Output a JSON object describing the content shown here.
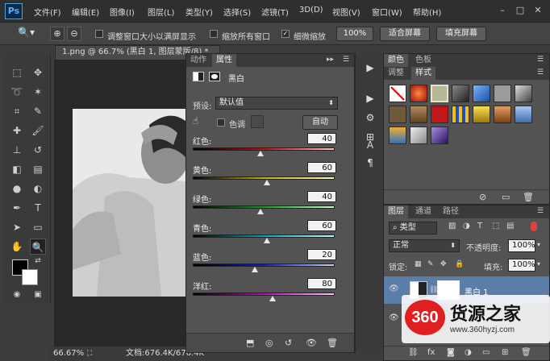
{
  "app": {
    "logo": "Ps"
  },
  "menu": [
    "文件(F)",
    "编辑(E)",
    "图像(I)",
    "图层(L)",
    "类型(Y)",
    "选择(S)",
    "滤镜(T)",
    "3D(D)",
    "视图(V)",
    "窗口(W)",
    "帮助(H)"
  ],
  "window_controls": [
    "–",
    "□",
    "✕"
  ],
  "options": {
    "resize_window": "调整窗口大小以满屏显示",
    "zoom_all": "缩放所有窗口",
    "scrubby_zoom": "细微缩放",
    "zoom_100": "100%",
    "fit_screen": "适合屏幕",
    "fill_screen": "填充屏幕"
  },
  "document": {
    "tab_title": "1.png @ 66.7% (黑白 1, 图层蒙版/8) *",
    "zoom": "66.67%",
    "doc_info": "文档:676.4K/676.4K"
  },
  "properties": {
    "tabs": [
      "动作",
      "属性"
    ],
    "title": "黑白",
    "preset_label": "预设:",
    "preset_value": "默认值",
    "tint_label": "色调",
    "auto_button": "自动",
    "sliders": [
      {
        "label": "红色:",
        "value": 40
      },
      {
        "label": "黄色:",
        "value": 60
      },
      {
        "label": "绿色:",
        "value": 40
      },
      {
        "label": "青色:",
        "value": 60
      },
      {
        "label": "蓝色:",
        "value": 20
      },
      {
        "label": "洋红:",
        "value": 80
      }
    ]
  },
  "color_panel": {
    "tabs": [
      "颜色",
      "色板"
    ]
  },
  "styles_panel": {
    "tabs": [
      "调整",
      "样式"
    ]
  },
  "layers_panel": {
    "tabs": [
      "图层",
      "通道",
      "路径"
    ],
    "filter": "类型",
    "blend_mode": "正常",
    "opacity_label": "不透明度:",
    "opacity_value": "100%",
    "lock_label": "锁定:",
    "fill_label": "填充:",
    "fill_value": "100%",
    "layers": [
      {
        "name": "黑白 1"
      }
    ]
  },
  "watermark": {
    "brand": "360",
    "title": "货源之家",
    "url": "www.360hyzj.com"
  },
  "colors": {
    "accent": "#4fa3e0",
    "panel": "#535353",
    "dark": "#3a3a3a"
  }
}
